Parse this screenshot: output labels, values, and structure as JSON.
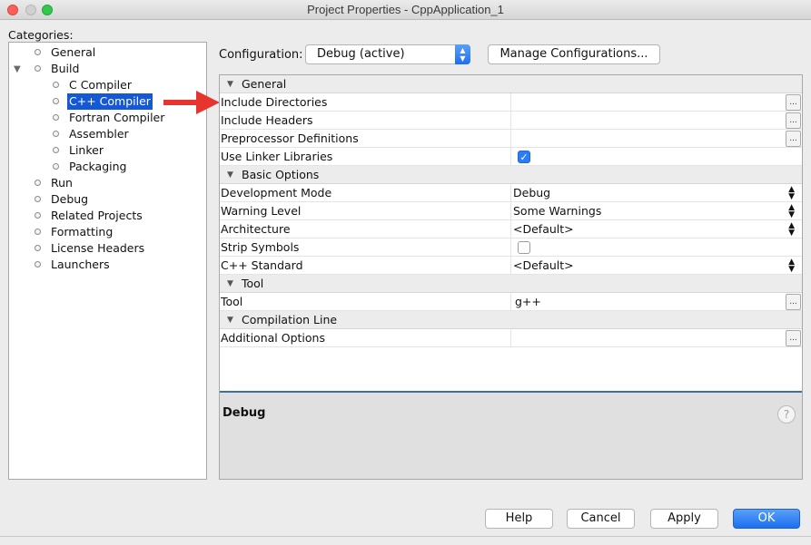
{
  "window": {
    "title": "Project Properties - CppApplication_1"
  },
  "categories": {
    "label": "Categories:",
    "items": [
      {
        "label": "General"
      },
      {
        "label": "Build",
        "expander": "▼"
      },
      {
        "label": "C Compiler"
      },
      {
        "label": "C++ Compiler"
      },
      {
        "label": "Fortran Compiler"
      },
      {
        "label": "Assembler"
      },
      {
        "label": "Linker"
      },
      {
        "label": "Packaging"
      },
      {
        "label": "Run"
      },
      {
        "label": "Debug"
      },
      {
        "label": "Related Projects"
      },
      {
        "label": "Formatting"
      },
      {
        "label": "License Headers"
      },
      {
        "label": "Launchers"
      }
    ],
    "selected": "C++ Compiler"
  },
  "annotation": {
    "arrow_color": "#e8342e"
  },
  "configuration": {
    "label": "Configuration:",
    "selected": "Debug (active)",
    "manage_label": "Manage Configurations..."
  },
  "properties": {
    "sections": [
      {
        "title": "General"
      },
      {
        "title": "Basic Options"
      },
      {
        "title": "Tool"
      },
      {
        "title": "Compilation Line"
      }
    ],
    "rows": {
      "include_directories": {
        "name": "Include Directories",
        "value": "",
        "button": "..."
      },
      "include_headers": {
        "name": "Include Headers",
        "value": "",
        "button": "..."
      },
      "preprocessor_definitions": {
        "name": "Preprocessor Definitions",
        "value": "",
        "button": "..."
      },
      "use_linker_libraries": {
        "name": "Use Linker Libraries",
        "checked": true
      },
      "development_mode": {
        "name": "Development Mode",
        "value": "Debug"
      },
      "warning_level": {
        "name": "Warning Level",
        "value": "Some Warnings"
      },
      "architecture": {
        "name": "Architecture",
        "value": "<Default>"
      },
      "strip_symbols": {
        "name": "Strip Symbols",
        "checked": false
      },
      "cpp_standard": {
        "name": "C++ Standard",
        "value": "<Default>"
      },
      "tool": {
        "name": "Tool",
        "value": "g++",
        "button": "..."
      },
      "additional_options": {
        "name": "Additional Options",
        "value": "",
        "button": "..."
      }
    }
  },
  "description": {
    "title": "Debug",
    "help_symbol": "?"
  },
  "buttons": {
    "help": "Help",
    "cancel": "Cancel",
    "apply": "Apply",
    "ok": "OK"
  },
  "colors": {
    "selection": "#1558d6",
    "accent": "#1d6ff0"
  }
}
